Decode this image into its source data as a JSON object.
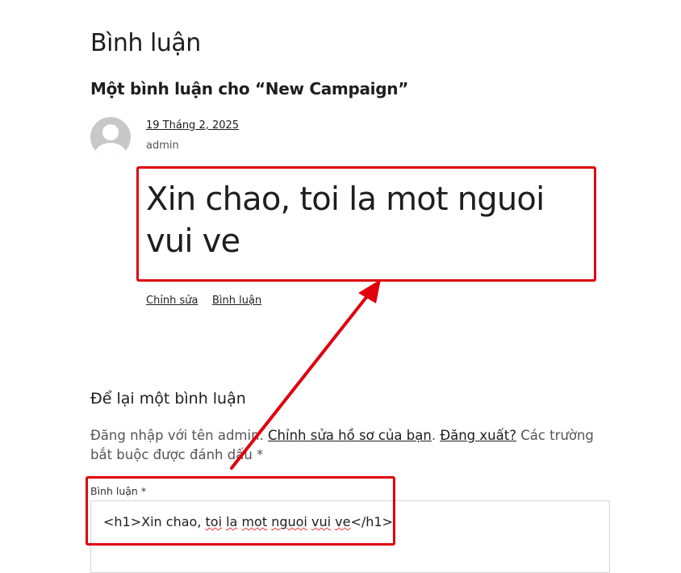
{
  "comments": {
    "section_title": "Bình luận",
    "count_heading": "Một bình luận cho “New Campaign”",
    "items": [
      {
        "date": "19 Tháng 2, 2025",
        "author": "admin",
        "content": "Xin chao, toi la mot nguoi vui ve",
        "edit_label": "Chỉnh sửa",
        "reply_label": "Bình luận"
      }
    ]
  },
  "reply_form": {
    "title": "Để lại một bình luận",
    "logged_in_prefix": "Đăng nhập với tên admin.",
    "edit_profile_link": "Chỉnh sửa hồ sơ của bạn",
    "separator": ".",
    "logout_link": "Đăng xuất?",
    "required_note": "Các trường bắt buộc được đánh dấu *",
    "comment_label": "Bình luận *",
    "comment_value_tag_open": "<h1>",
    "comment_value_text": "Xin chao, toi la mot nguoi vui ve",
    "comment_value_tag_close": "</h1>"
  },
  "annotations": {
    "color": "#e0000e"
  }
}
